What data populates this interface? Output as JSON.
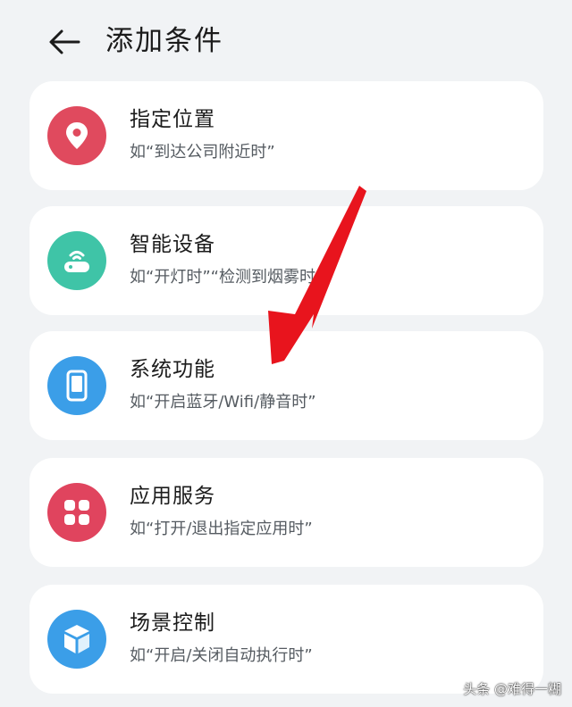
{
  "header": {
    "title": "添加条件"
  },
  "cards": [
    {
      "title": "指定位置",
      "desc": "如“到达公司附近时”",
      "icon": "location-pin-icon",
      "color": "#e04a5e"
    },
    {
      "title": "智能设备",
      "desc": "如“开灯时”“检测到烟雾时”",
      "icon": "router-icon",
      "color": "#3fc4a7"
    },
    {
      "title": "系统功能",
      "desc": "如“开启蓝牙/Wifi/静音时”",
      "icon": "phone-icon",
      "color": "#3b9ee8"
    },
    {
      "title": "应用服务",
      "desc": "如“打开/退出指定应用时”",
      "icon": "apps-grid-icon",
      "color": "#e0445e"
    },
    {
      "title": "场景控制",
      "desc": "如“开启/关闭自动执行时”",
      "icon": "cube-icon",
      "color": "#3b9ee8"
    }
  ],
  "watermark": "头条 @难得一糊",
  "annotation_color": "#e8141d"
}
